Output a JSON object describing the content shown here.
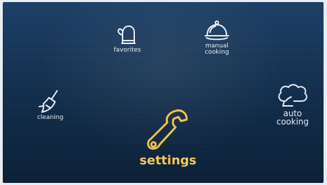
{
  "menu": {
    "favorites": {
      "label": "favorites",
      "icon": "oven-mitt-icon"
    },
    "manual_cooking": {
      "label": "manual\ncooking",
      "icon": "cloche-icon"
    },
    "cleaning": {
      "label": "cleaning",
      "icon": "broom-icon"
    },
    "settings": {
      "label": "settings",
      "icon": "wrench-icon",
      "selected": true
    },
    "auto_cooking": {
      "label": "auto\ncooking",
      "icon": "chef-hat-icon"
    }
  },
  "colors": {
    "background": "#102c4a",
    "icon": "#e8eef7",
    "selected": "#f1c24e"
  }
}
